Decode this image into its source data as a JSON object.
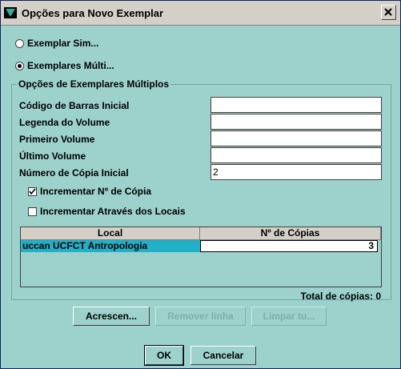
{
  "window": {
    "title": "Opções para Novo Exemplar"
  },
  "options": {
    "single": "Exemplar Sim...",
    "multiple": "Exemplares Múlti..."
  },
  "group": {
    "title": "Opções de Exemplares Múltiplos",
    "fields": [
      {
        "label": "Código de Barras Inicial",
        "value": ""
      },
      {
        "label": "Legenda do Volume",
        "value": ""
      },
      {
        "label": "Primeiro Volume",
        "value": ""
      },
      {
        "label": "Último Volume",
        "value": ""
      },
      {
        "label": "Número de Cópia Inicial",
        "value": "2"
      }
    ],
    "checks": [
      {
        "label": "Incrementar Nº de Cópia",
        "checked": true
      },
      {
        "label": "Incrementar Através dos Locais",
        "checked": false
      }
    ],
    "table": {
      "columns": [
        "Local",
        "Nº de Cópias"
      ],
      "rows": [
        {
          "local": "uccan UCFCT Antropologia",
          "copies": "3"
        }
      ]
    },
    "total": "Total de cópias: 0",
    "buttons": {
      "add": "Acrescen...",
      "remove": "Remover linha",
      "clear": "Limpar tu..."
    }
  },
  "footer": {
    "ok": "OK",
    "cancel": "Cancelar"
  }
}
